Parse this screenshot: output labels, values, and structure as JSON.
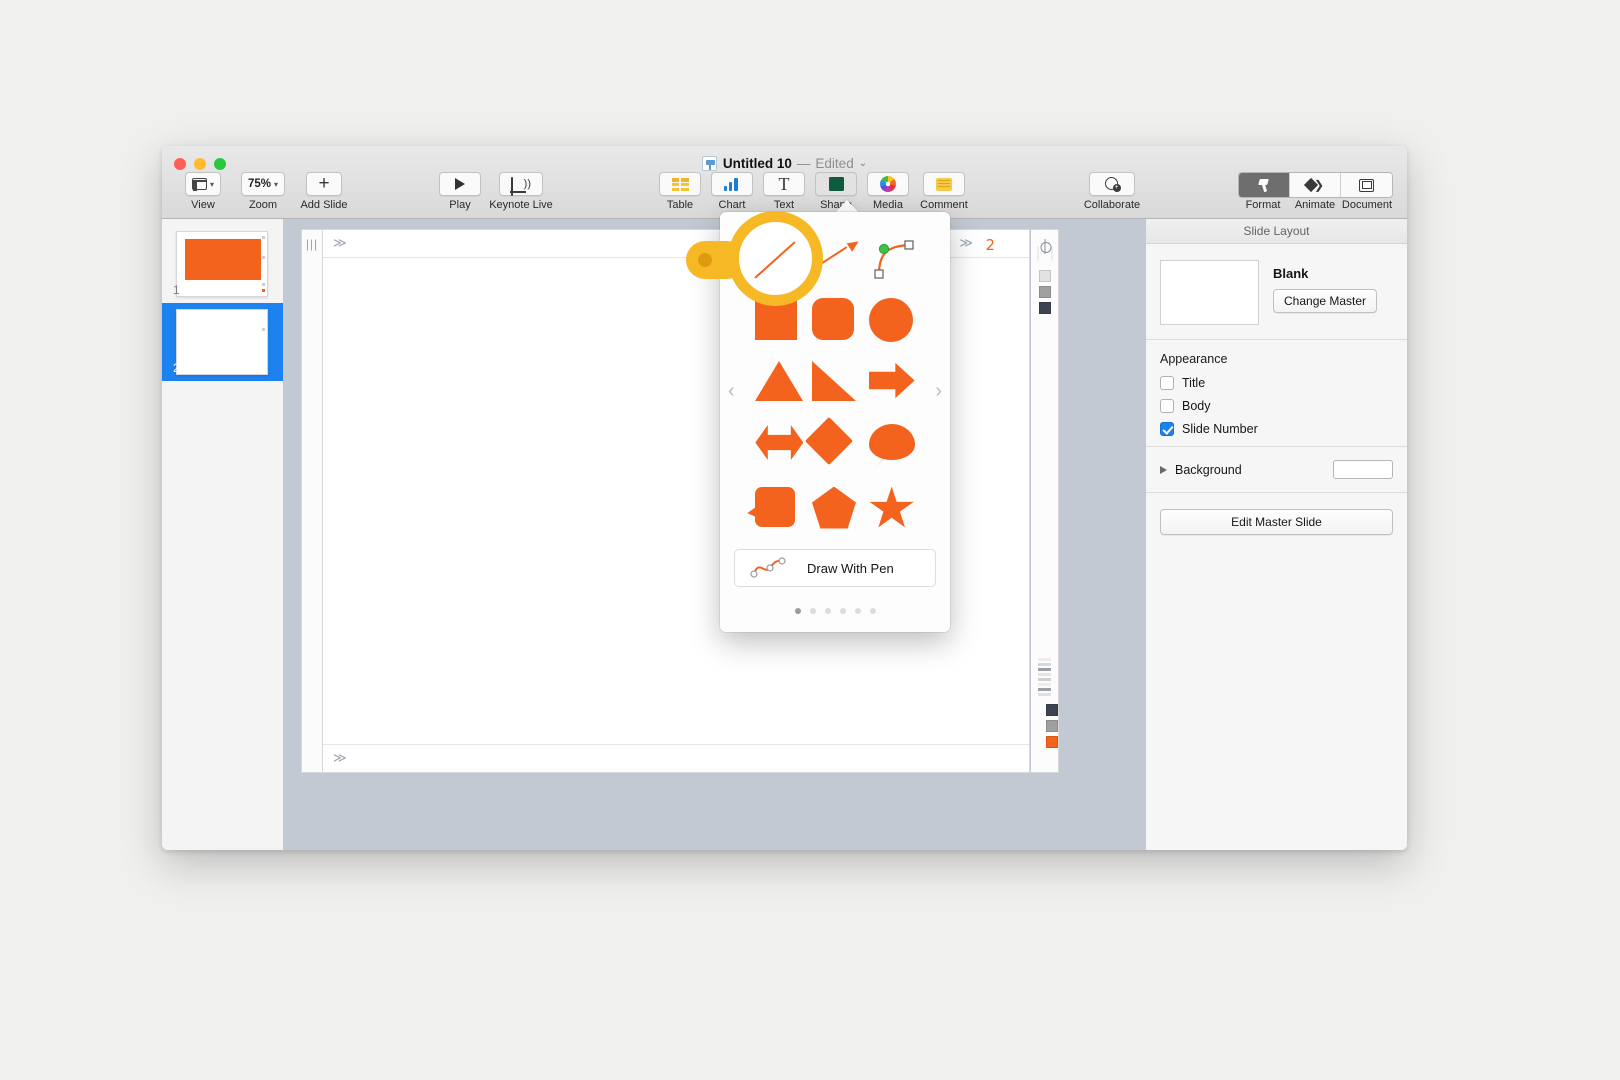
{
  "window": {
    "title_name": "Untitled 10",
    "title_dash": "—",
    "title_state": "Edited",
    "title_chevron": "⌄",
    "app_icon": "keynote-icon"
  },
  "toolbar": {
    "left_items": [
      {
        "label": "View",
        "icon": "view-layout-icon",
        "chevron": "⌄"
      },
      {
        "label": "Zoom",
        "value": "75%",
        "icon": "zoom-percent",
        "chevron": "⌄"
      },
      {
        "label": "Add Slide",
        "icon": "plus-icon"
      }
    ],
    "play_items": [
      {
        "label": "Play",
        "icon": "play-icon"
      },
      {
        "label": "Keynote Live",
        "icon": "keynote-live-icon"
      }
    ],
    "insert_items": [
      {
        "label": "Table",
        "icon": "table-icon"
      },
      {
        "label": "Chart",
        "icon": "chart-icon"
      },
      {
        "label": "Text",
        "icon": "text-icon"
      },
      {
        "label": "Shape",
        "icon": "shape-icon"
      },
      {
        "label": "Media",
        "icon": "media-icon"
      },
      {
        "label": "Comment",
        "icon": "comment-icon"
      }
    ],
    "collaborate": {
      "label": "Collaborate",
      "icon": "collaborate-icon"
    },
    "inspector_tabs": [
      {
        "label": "Format",
        "icon": "format-brush-icon",
        "active": true
      },
      {
        "label": "Animate",
        "icon": "animate-diamond-icon",
        "active": false
      },
      {
        "label": "Document",
        "icon": "document-icon",
        "active": false
      }
    ]
  },
  "navigator": {
    "slides": [
      {
        "number": "1",
        "selected": false,
        "has_orange_rect": true
      },
      {
        "number": "2",
        "selected": true,
        "has_orange_rect": false
      }
    ]
  },
  "canvas": {
    "slide_number_placeholder": "2",
    "top_chevron": "≫",
    "right_chevron": "≫",
    "bottom_chevron": "≫",
    "grip": "|||",
    "target_icon": "alignment-target-icon"
  },
  "inspector": {
    "title": "Slide Layout",
    "master_name": "Blank",
    "change_master_label": "Change Master",
    "appearance": {
      "heading": "Appearance",
      "options": [
        {
          "label": "Title",
          "checked": false
        },
        {
          "label": "Body",
          "checked": false
        },
        {
          "label": "Slide Number",
          "checked": true
        }
      ]
    },
    "background": {
      "label": "Background",
      "disclosure": "collapsed"
    },
    "edit_master_label": "Edit Master Slide"
  },
  "shapes_popover": {
    "shapes": [
      {
        "name": "line",
        "row": 1
      },
      {
        "name": "arrow-line",
        "row": 1
      },
      {
        "name": "bezier-curve",
        "row": 1
      },
      {
        "name": "square",
        "row": 2
      },
      {
        "name": "rounded-rectangle",
        "row": 2
      },
      {
        "name": "circle",
        "row": 2
      },
      {
        "name": "triangle",
        "row": 3
      },
      {
        "name": "right-triangle",
        "row": 3
      },
      {
        "name": "arrow",
        "row": 3
      },
      {
        "name": "double-arrow",
        "row": 4
      },
      {
        "name": "diamond",
        "row": 4
      },
      {
        "name": "speech-bubble",
        "row": 4
      },
      {
        "name": "quote-bubble",
        "row": 5
      },
      {
        "name": "pentagon",
        "row": 5
      },
      {
        "name": "star",
        "row": 5
      }
    ],
    "draw_with_pen_label": "Draw With Pen",
    "nav_prev": "‹",
    "nav_next": "›",
    "page_count": 6,
    "page_active_index": 0
  },
  "magnifier": {
    "target": "line-shape-tool",
    "ring_color": "#f7b826",
    "content_color": "#f4631e"
  },
  "colors": {
    "accent_orange": "#f4631e",
    "selection_blue": "#1b82f0",
    "highlight_yellow": "#f7b826",
    "shape_icon_green": "#0d5c3e"
  }
}
